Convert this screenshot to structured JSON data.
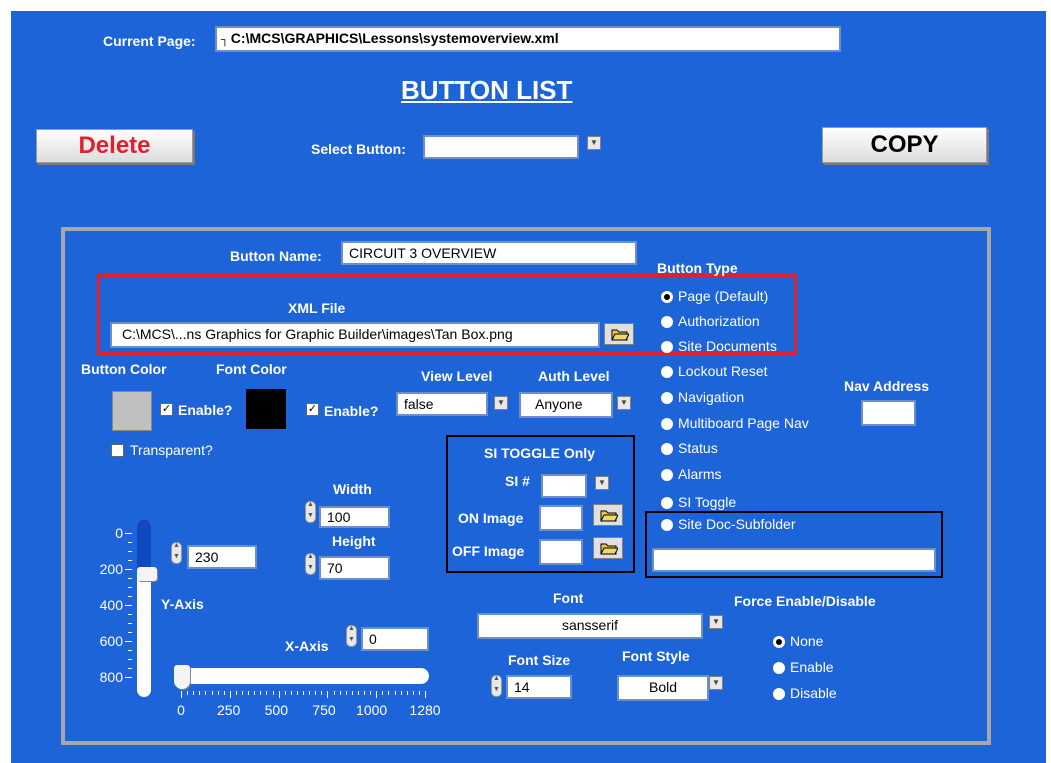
{
  "header": {
    "current_page_label": "Current Page:",
    "current_page_value": "C:\\MCS\\GRAPHICS\\Lessons\\systemoverview.xml"
  },
  "title": "BUTTON LIST",
  "toolbar": {
    "delete_label": "Delete",
    "select_button_label": "Select Button:",
    "select_button_value": "",
    "copy_label": "COPY"
  },
  "editor": {
    "button_name_label": "Button Name:",
    "button_name_value": "CIRCUIT 3 OVERVIEW",
    "xml_file_label": "XML File",
    "xml_file_value": "C:\\MCS\\...ns Graphics for Graphic Builder\\images\\Tan Box.png",
    "button_color_label": "Button Color",
    "font_color_label": "Font Color",
    "enable_label_1": "Enable?",
    "enable_label_2": "Enable?",
    "transparent_label": "Transparent?",
    "view_level_label": "View Level",
    "view_level_value": "false",
    "auth_level_label": "Auth Level",
    "auth_level_value": "Anyone",
    "si_toggle_label": "SI TOGGLE Only",
    "si_number_label": "SI #",
    "si_number_value": "",
    "on_image_label": "ON Image",
    "on_image_value": "",
    "off_image_label": "OFF Image",
    "off_image_value": "",
    "width_label": "Width",
    "width_value": "100",
    "height_label": "Height",
    "height_value": "70",
    "y_axis_label": "Y-Axis",
    "y_axis_value": "230",
    "y_ticks": [
      "0",
      "200",
      "400",
      "600",
      "800"
    ],
    "x_axis_label": "X-Axis",
    "x_axis_value": "0",
    "x_ticks": [
      "0",
      "250",
      "500",
      "750",
      "1000",
      "1280"
    ],
    "font_label": "Font",
    "font_value": "sansserif",
    "font_size_label": "Font Size",
    "font_size_value": "14",
    "font_style_label": "Font Style",
    "font_style_value": "Bold",
    "button_type_label": "Button Type",
    "button_types": [
      "Page (Default)",
      "Authorization",
      "Site Documents",
      "Lockout Reset",
      "Navigation",
      "Multiboard Page Nav",
      "Status",
      "Alarms",
      "SI Toggle",
      "Site Doc-Subfolder"
    ],
    "button_type_selected": "Page (Default)",
    "nav_address_label": "Nav Address",
    "nav_address_value": "",
    "subfolder_value": "",
    "force_label": "Force Enable/Disable",
    "force_options": [
      "None",
      "Enable",
      "Disable"
    ],
    "force_selected": "None"
  },
  "colors": {
    "background": "#1c64d8",
    "button_color": "#c0c0c0",
    "font_color": "#000000",
    "delete_text": "#e0202a",
    "highlight_border": "#e0202a",
    "slider_fill": "#1048c0"
  }
}
